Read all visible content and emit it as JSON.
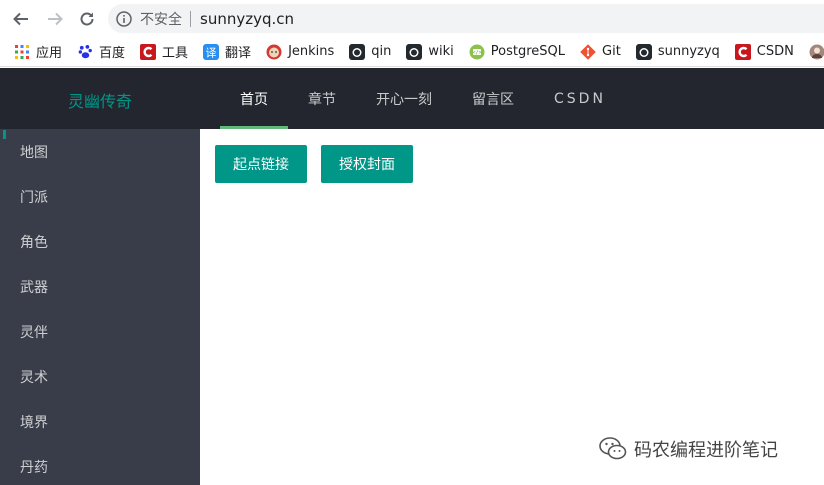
{
  "browser": {
    "security_label": "不安全",
    "url": "sunnyzyq.cn",
    "bookmarks": [
      {
        "label": "应用",
        "icon": "apps-grid-icon"
      },
      {
        "label": "百度",
        "icon": "baidu-paw-icon"
      },
      {
        "label": "工具",
        "icon": "csdn-c-icon"
      },
      {
        "label": "翻译",
        "icon": "translate-icon"
      },
      {
        "label": "Jenkins",
        "icon": "jenkins-icon"
      },
      {
        "label": "qin",
        "icon": "github-icon"
      },
      {
        "label": "wiki",
        "icon": "github-icon"
      },
      {
        "label": "PostgreSQL",
        "icon": "postgres-icon"
      },
      {
        "label": "Git",
        "icon": "git-icon"
      },
      {
        "label": "sunnyzyq",
        "icon": "github-icon"
      },
      {
        "label": "CSDN",
        "icon": "csdn-c-icon"
      }
    ]
  },
  "app": {
    "logo": "灵幽传奇",
    "nav": [
      "首页",
      "章节",
      "开心一刻",
      "留言区",
      "CSDN"
    ],
    "active_nav": 0,
    "sidebar": [
      "地图",
      "门派",
      "角色",
      "武器",
      "灵伴",
      "灵术",
      "境界",
      "丹药"
    ],
    "buttons": [
      "起点链接",
      "授权封面"
    ]
  },
  "watermark": "码农编程进阶笔记",
  "colors": {
    "header_bg": "#23262e",
    "sidebar_bg": "#393d49",
    "accent": "#009688",
    "tab_underline": "#5fb878"
  }
}
